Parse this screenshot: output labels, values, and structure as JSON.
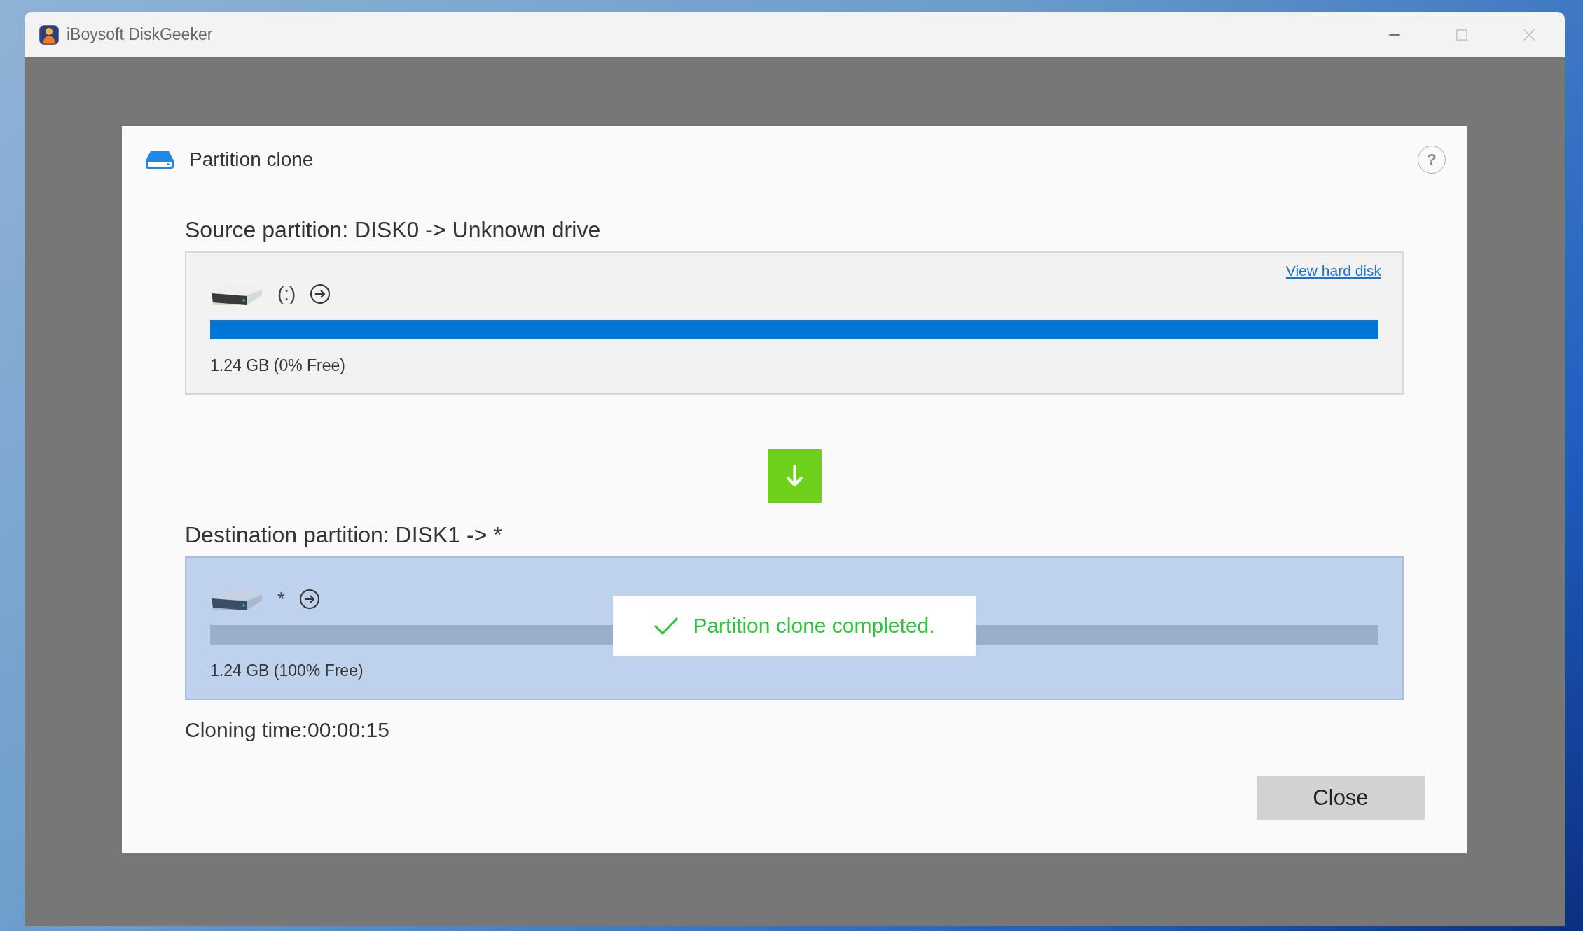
{
  "window": {
    "title": "iBoysoft DiskGeeker"
  },
  "dialog": {
    "title": "Partition clone",
    "help": "?",
    "partitions": [
      {
        "heading": "Source partition: DISK0 -> Unknown drive",
        "label": "(:)",
        "level": 1,
        "size": "1.24 GB (0% Free)",
        "selected": false,
        "link": "View hard disk"
      },
      {
        "heading": "Destination partition: DISK1 -> *",
        "label": "*",
        "level": 0,
        "size": "1.24 GB (100% Free)",
        "selected": true
      }
    ],
    "toast": "Partition clone completed.",
    "cloning_time": "Cloning time:00:00:15",
    "buttons": [
      "Close"
    ]
  }
}
